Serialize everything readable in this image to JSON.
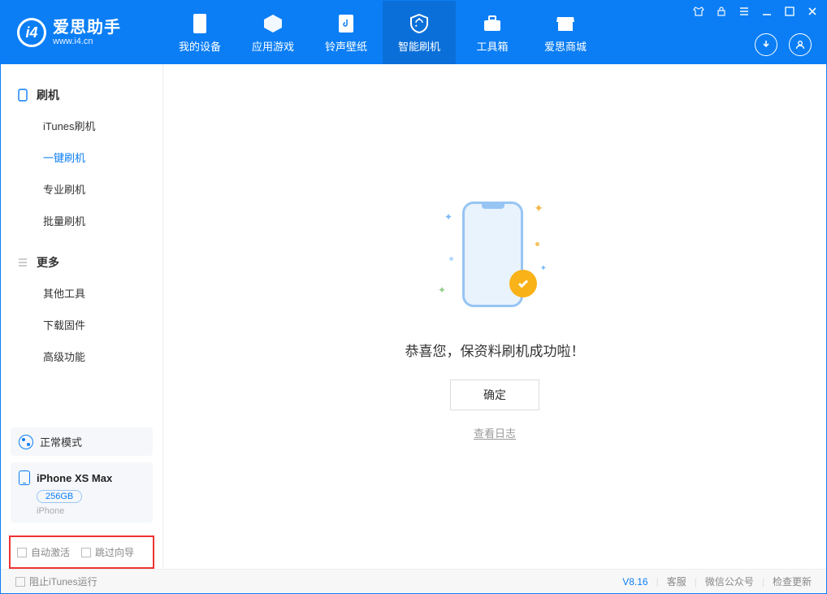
{
  "header": {
    "logo_title": "爱思助手",
    "logo_sub": "www.i4.cn",
    "tabs": [
      {
        "label": "我的设备"
      },
      {
        "label": "应用游戏"
      },
      {
        "label": "铃声壁纸"
      },
      {
        "label": "智能刷机"
      },
      {
        "label": "工具箱"
      },
      {
        "label": "爱思商城"
      }
    ]
  },
  "sidebar": {
    "group1_title": "刷机",
    "group1_items": [
      "iTunes刷机",
      "一键刷机",
      "专业刷机",
      "批量刷机"
    ],
    "group2_title": "更多",
    "group2_items": [
      "其他工具",
      "下载固件",
      "高级功能"
    ],
    "mode_label": "正常模式",
    "device_name": "iPhone XS Max",
    "device_storage": "256GB",
    "device_type": "iPhone",
    "opt_auto_activate": "自动激活",
    "opt_skip_guide": "跳过向导"
  },
  "main": {
    "success_msg": "恭喜您，保资料刷机成功啦！",
    "ok_label": "确定",
    "log_label": "查看日志"
  },
  "footer": {
    "block_itunes": "阻止iTunes运行",
    "version": "V8.16",
    "links": [
      "客服",
      "微信公众号",
      "检查更新"
    ]
  }
}
